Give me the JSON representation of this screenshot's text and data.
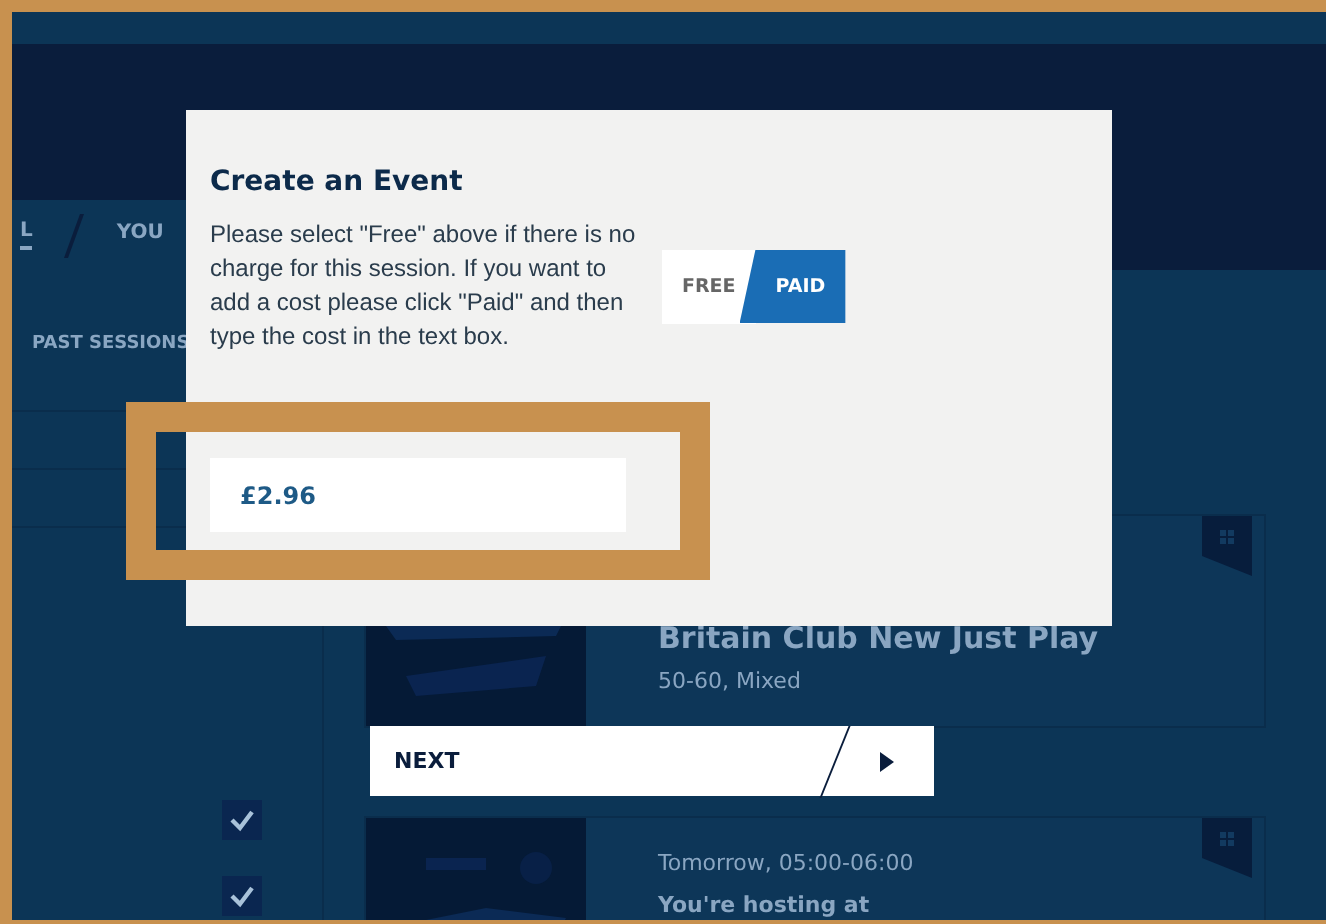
{
  "background_page": {
    "tabs": [
      {
        "label": "L",
        "selected": true
      },
      {
        "label": "YOU",
        "selected": false
      }
    ],
    "sidebar": {
      "heading": "PAST SESSIONS",
      "checkboxes": [
        {
          "checked": true
        },
        {
          "checked": true
        }
      ]
    },
    "sessions": [
      {
        "title": "Britain Club New Just Play",
        "details": "50-60, Mixed"
      },
      {
        "time": "Tomorrow, 05:00-06:00",
        "note": "You're hosting at"
      }
    ]
  },
  "dialog": {
    "title": "Create an Event",
    "description": "Please select \"Free\" above if there is no charge for this session. If you want to add a cost please click \"Paid\" and then type the cost in the text box.",
    "price_toggle": [
      {
        "label": "FREE",
        "selected": false
      },
      {
        "label": "PAID",
        "selected": true
      }
    ],
    "cost_field": {
      "value": "£2.96",
      "highlighted": true
    }
  },
  "next_button": {
    "label": "NEXT"
  }
}
